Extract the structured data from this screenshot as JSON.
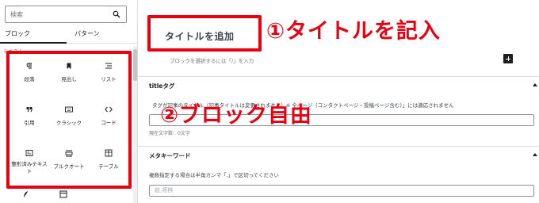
{
  "inserter": {
    "search_placeholder": "検索",
    "tabs": [
      {
        "label": "ブロック"
      },
      {
        "label": "パターン"
      }
    ],
    "section_title": "テキスト",
    "blocks": [
      {
        "label": "段落",
        "icon": "paragraph-icon"
      },
      {
        "label": "見出し",
        "icon": "bookmark-icon"
      },
      {
        "label": "リスト",
        "icon": "list-icon"
      },
      {
        "label": "引用",
        "icon": "quote-icon"
      },
      {
        "label": "クラシック",
        "icon": "keyboard-icon"
      },
      {
        "label": "コード",
        "icon": "code-icon"
      },
      {
        "label": "整形済みテキスト",
        "icon": "preformatted-icon"
      },
      {
        "label": "プルクオート",
        "icon": "pullquote-icon"
      },
      {
        "label": "テーブル",
        "icon": "table-icon"
      }
    ]
  },
  "editor": {
    "title_placeholder": "タイトルを追加",
    "block_hint": "ブロックを選択するには「/」を入力",
    "annotation_1": "①タイトルを記入",
    "annotation_2": "②ブロック自由",
    "title_meta": {
      "header": "titleタグ",
      "desc": "タグが記事のタイトル（記事タイトルは変更されません）※ 全ページ（コンタクトページ・投稿ページ含む）」には適応されません",
      "count": "現在文字数：0文字"
    },
    "keyword_meta": {
      "header": "メタキーワード",
      "desc": "複数指定する場合は半角カンマ「,」で区切ってください",
      "placeholder": "絵,将棋"
    }
  },
  "colors": {
    "annotation_red": "#e60012",
    "text_dark": "#1e1e1e"
  }
}
